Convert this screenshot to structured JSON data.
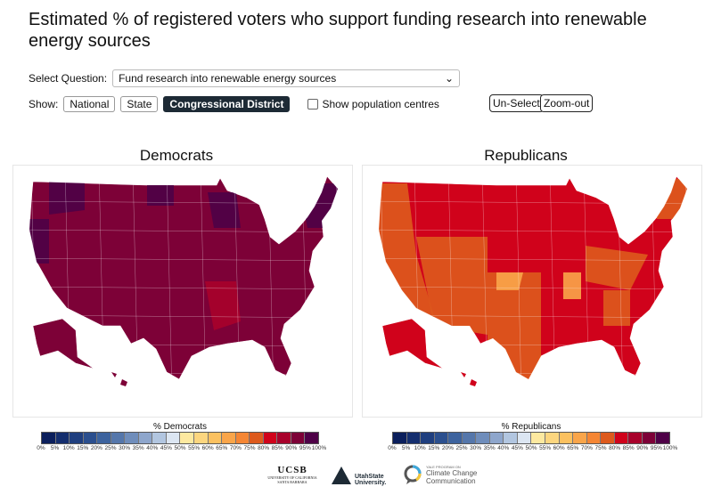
{
  "title": "Estimated % of registered voters who support funding research into renewable energy sources",
  "controls": {
    "select_label": "Select Question:",
    "select_value": "Fund research into renewable energy sources",
    "show_label": "Show:",
    "show_options": [
      "National",
      "State",
      "Congressional District"
    ],
    "show_selected": "Congressional District",
    "population_label": "Show population centres",
    "population_checked": false,
    "unselect": "Un-Select",
    "zoomout": "Zoom-out"
  },
  "maps": [
    {
      "title": "Democrats",
      "legend_title": "% Democrats",
      "main_color": "#7d0137",
      "secondary_color": "#4e0147",
      "accent_color": "#a8012b"
    },
    {
      "title": "Republicans",
      "legend_title": "% Republicans",
      "main_color": "#d0021b",
      "secondary_color": "#dd5a1d",
      "accent_color": "#f9a54a"
    }
  ],
  "legend": {
    "colors": [
      "#0b1f5c",
      "#142e6e",
      "#1f3f7f",
      "#2b4f8e",
      "#3d639e",
      "#5577ab",
      "#6f8dbb",
      "#8ea6cc",
      "#b2c6e0",
      "#dce6f2",
      "#fde9a0",
      "#fcd67f",
      "#fbc160",
      "#f9a54a",
      "#f58634",
      "#dd5a1d",
      "#d0021b",
      "#a8012b",
      "#7d0137",
      "#4e0147"
    ],
    "ticks": [
      "0%",
      "5%",
      "10%",
      "15%",
      "20%",
      "25%",
      "30%",
      "35%",
      "40%",
      "45%",
      "50%",
      "55%",
      "60%",
      "65%",
      "70%",
      "75%",
      "80%",
      "85%",
      "90%",
      "95%",
      "100%"
    ]
  },
  "logos": {
    "ucsb": "UCSB",
    "ucsb_sub": "UNIVERSITY OF CALIFORNIA SANTA BARBARA",
    "usu": "UtahState University.",
    "yale_small": "YALE PROGRAM ON",
    "yale": "Climate Change Communication"
  }
}
